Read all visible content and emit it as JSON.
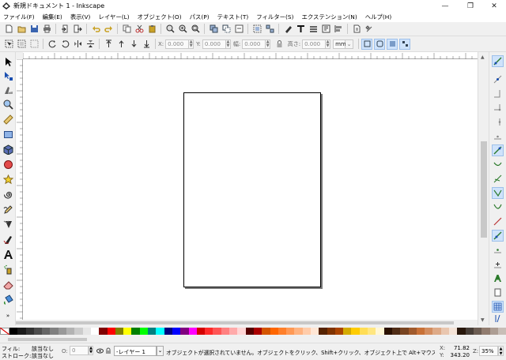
{
  "window": {
    "title": "新規ドキュメント 1 - Inkscape",
    "minimize": "—",
    "maximize": "❐",
    "close": "✕"
  },
  "menu": [
    "ファイル(F)",
    "編集(E)",
    "表示(V)",
    "レイヤー(L)",
    "オブジェクト(O)",
    "パス(P)",
    "テキスト(T)",
    "フィルター(S)",
    "エクステンション(N)",
    "ヘルプ(H)"
  ],
  "toolbar2": {
    "x_label": "X:",
    "x_value": "0.000",
    "y_label": "Y:",
    "y_value": "0.000",
    "w_label": "幅:",
    "w_value": "0.000",
    "h_label": "高さ:",
    "h_value": "0.000",
    "unit": "mm"
  },
  "status": {
    "fill_label": "フィル:",
    "fill_value": "該当なし",
    "stroke_label": "ストローク:",
    "stroke_value": "該当なし",
    "opacity_label": "O:",
    "opacity_value": "0",
    "layer": "-レイヤー 1",
    "message": "オブジェクトが選択されていません。オブジェクトをクリック、Shift+クリック、オブジェクト上で Alt+マウススクロール、また...",
    "x_label": "X:",
    "x_value": "71.82",
    "y_label": "Y:",
    "y_value": "343.20",
    "zoom_label": "Z:",
    "zoom_value": "35%"
  },
  "colors": {
    "accent": "#cfe3fb",
    "palette": [
      "#000000",
      "#1a1a1a",
      "#333333",
      "#4d4d4d",
      "#666666",
      "#808080",
      "#999999",
      "#b3b3b3",
      "#cccccc",
      "#e6e6e6",
      "#ffffff",
      "#800000",
      "#ff0000",
      "#808000",
      "#ffff00",
      "#008000",
      "#00ff00",
      "#008080",
      "#00ffff",
      "#000080",
      "#0000ff",
      "#800080",
      "#ff00ff",
      "#d40000",
      "#ff2a2a",
      "#ff5555",
      "#ff8080",
      "#ffaaaa",
      "#ffd5d5",
      "#550000",
      "#aa0000",
      "#d45500",
      "#ff6600",
      "#ff7f2a",
      "#ff9955",
      "#ffb380",
      "#ffccaa",
      "#ffe6d5",
      "#552200",
      "#803300",
      "#aa4400",
      "#d4aa00",
      "#ffcc00",
      "#ffdd55",
      "#ffe680",
      "#fff6d5",
      "#2b1100",
      "#502d16",
      "#784421",
      "#a05a2c",
      "#c87137",
      "#d38d5f",
      "#deaa87",
      "#e9c6af",
      "#f4e3d7",
      "#28170b",
      "#483e37",
      "#6c5d53",
      "#917c6f",
      "#ac9d93",
      "#c8beb7"
    ]
  }
}
